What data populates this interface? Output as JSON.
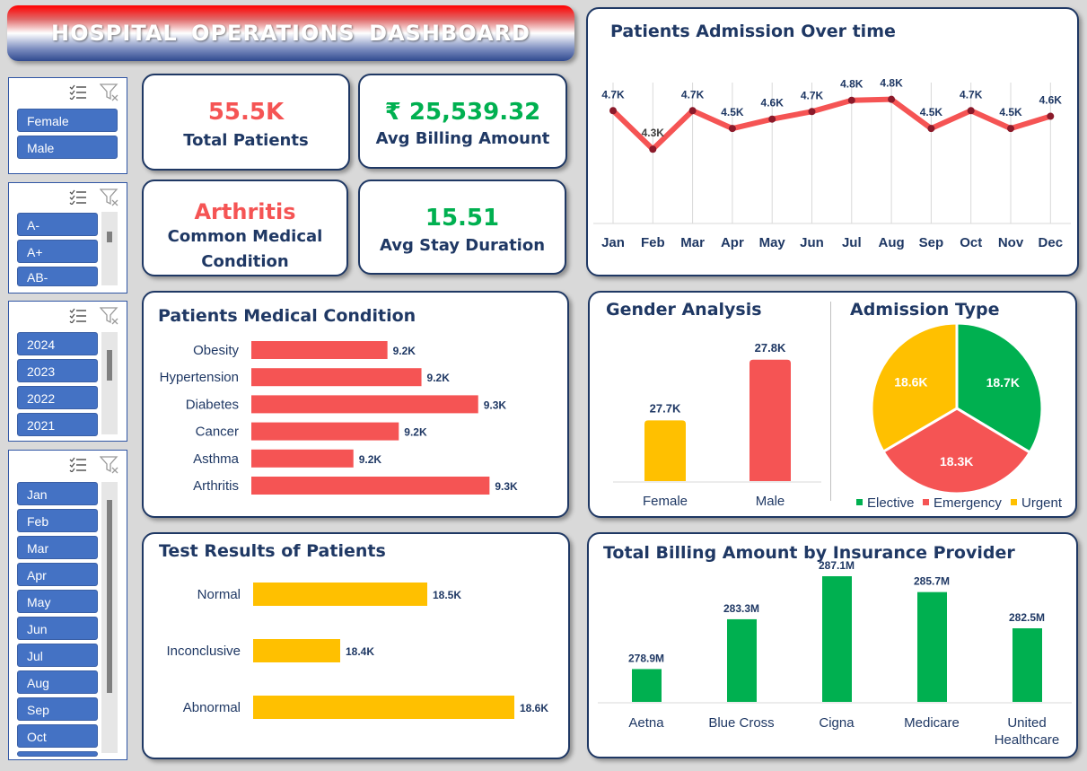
{
  "header": {
    "title": "HOSPITAL  OPERATIONS  DASHBOARD"
  },
  "slicers": {
    "gender": [
      "Female",
      "Male"
    ],
    "blood_type": [
      "A-",
      "A+",
      "AB-"
    ],
    "year": [
      "2024",
      "2023",
      "2022",
      "2021"
    ],
    "month": [
      "Jan",
      "Feb",
      "Mar",
      "Apr",
      "May",
      "Jun",
      "Jul",
      "Aug",
      "Sep",
      "Oct"
    ]
  },
  "kpis": {
    "total_patients": {
      "value": "55.5K",
      "label": "Total Patients"
    },
    "avg_billing": {
      "value": "₹ 25,539.32",
      "label": "Avg Billing Amount"
    },
    "common_condition": {
      "value": "Arthritis",
      "label_line1": "Common Medical",
      "label_line2": "Condition"
    },
    "avg_stay": {
      "value": "15.51",
      "label": "Avg Stay Duration"
    }
  },
  "colors": {
    "red": "#f55454",
    "green": "#00b050",
    "navy": "#1f3864",
    "yellow": "#ffc000",
    "slicer_blue": "#4472c4"
  },
  "chart_data": [
    {
      "id": "admissions",
      "type": "line",
      "title": "Patients Admission  Over time",
      "categories": [
        "Jan",
        "Feb",
        "Mar",
        "Apr",
        "May",
        "Jun",
        "Jul",
        "Aug",
        "Sep",
        "Oct",
        "Nov",
        "Dec"
      ],
      "values": [
        4.69,
        4.28,
        4.69,
        4.5,
        4.6,
        4.68,
        4.8,
        4.81,
        4.5,
        4.69,
        4.5,
        4.63
      ],
      "labels": [
        "4.7K",
        "4.3K",
        "4.7K",
        "4.5K",
        "4.6K",
        "4.7K",
        "4.8K",
        "4.8K",
        "4.5K",
        "4.7K",
        "4.5K",
        "4.6K"
      ],
      "ylim": [
        3.5,
        4.95
      ],
      "grid": "vertical"
    },
    {
      "id": "medical_condition",
      "type": "bar",
      "orientation": "horizontal",
      "title": "Patients Medical Condition",
      "categories": [
        "Obesity",
        "Hypertension",
        "Diabetes",
        "Cancer",
        "Asthma",
        "Arthritis"
      ],
      "values": [
        9.22,
        9.25,
        9.3,
        9.23,
        9.19,
        9.31
      ],
      "labels": [
        "9.2K",
        "9.2K",
        "9.3K",
        "9.2K",
        "9.2K",
        "9.3K"
      ],
      "xlim": [
        9.1,
        9.32
      ]
    },
    {
      "id": "gender",
      "type": "bar",
      "title": "Gender Analysis",
      "categories": [
        "Female",
        "Male"
      ],
      "values": [
        27.7,
        27.8
      ],
      "labels": [
        "27.7K",
        "27.8K"
      ],
      "ylim": [
        27.6,
        27.81
      ]
    },
    {
      "id": "admission_type",
      "type": "pie",
      "title": "Admission Type",
      "categories": [
        "Elective",
        "Emergency",
        "Urgent"
      ],
      "values": [
        18.7,
        18.3,
        18.6
      ],
      "labels": [
        "18.7K",
        "18.3K",
        "18.6K"
      ],
      "legend": "bottom"
    },
    {
      "id": "test_results",
      "type": "bar",
      "orientation": "horizontal",
      "title": "Test Results of Patients",
      "categories": [
        "Normal",
        "Inconclusive",
        "Abnormal"
      ],
      "values": [
        18.5,
        18.4,
        18.6
      ],
      "labels": [
        "18.5K",
        "18.4K",
        "18.6K"
      ],
      "xlim": [
        18.3,
        18.6
      ]
    },
    {
      "id": "billing_insurance",
      "type": "bar",
      "title": "Total Billing Amount by Insurance Provider",
      "categories": [
        "Aetna",
        "Blue Cross",
        "Cigna",
        "Medicare",
        "United Healthcare"
      ],
      "values": [
        278.9,
        283.3,
        287.1,
        285.7,
        282.5
      ],
      "labels": [
        "278.9M",
        "283.3M",
        "287.1M",
        "285.7M",
        "282.5M"
      ],
      "ylim": [
        276,
        287.1
      ]
    }
  ]
}
